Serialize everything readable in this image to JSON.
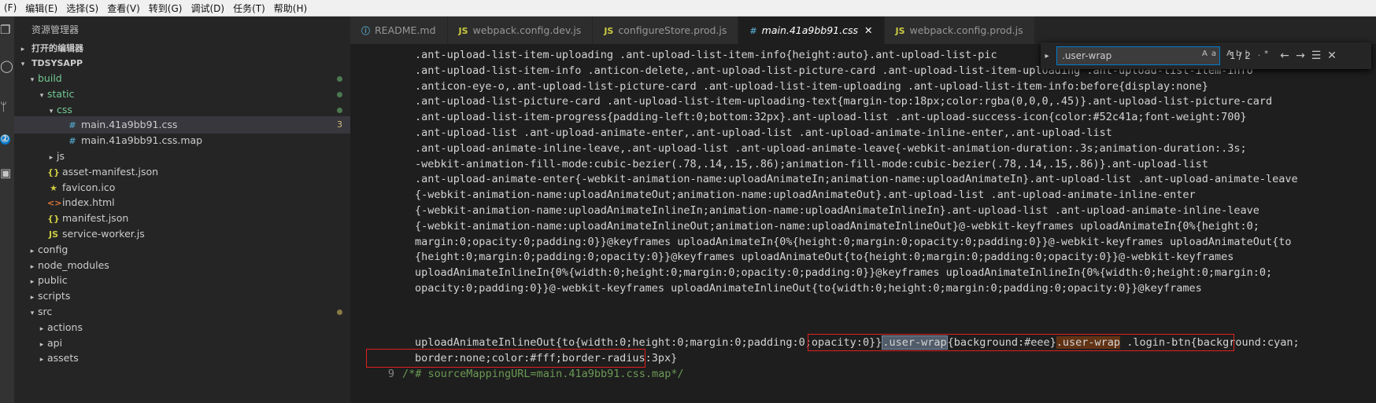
{
  "menu": [
    "(F)",
    "编辑(E)",
    "选择(S)",
    "查看(V)",
    "转到(G)",
    "调试(D)",
    "任务(T)",
    "帮助(H)"
  ],
  "sidebar": {
    "title": "资源管理器",
    "sections": {
      "open_editors": "打开的编辑器",
      "project": "TDSYSAPP"
    },
    "tree": [
      {
        "label": "build",
        "indent": 1,
        "twisty": "▾",
        "icon": "",
        "mod": true,
        "dot": "green"
      },
      {
        "label": "static",
        "indent": 2,
        "twisty": "▾",
        "icon": "",
        "mod": true,
        "dot": "green"
      },
      {
        "label": "css",
        "indent": 3,
        "twisty": "▾",
        "icon": "",
        "mod": true,
        "dot": "green"
      },
      {
        "label": "main.41a9bb91.css",
        "indent": 4,
        "twisty": "",
        "icon": "#",
        "iconColor": "#519aba",
        "selected": true,
        "count": "3"
      },
      {
        "label": "main.41a9bb91.css.map",
        "indent": 4,
        "twisty": "",
        "icon": "#",
        "iconColor": "#519aba"
      },
      {
        "label": "js",
        "indent": 3,
        "twisty": "▸",
        "icon": ""
      },
      {
        "label": "asset-manifest.json",
        "indent": 2,
        "twisty": "",
        "icon": "{}",
        "iconColor": "#cbcb41"
      },
      {
        "label": "favicon.ico",
        "indent": 2,
        "twisty": "",
        "icon": "★",
        "iconColor": "#cbcb41"
      },
      {
        "label": "index.html",
        "indent": 2,
        "twisty": "",
        "icon": "<>",
        "iconColor": "#e37933"
      },
      {
        "label": "manifest.json",
        "indent": 2,
        "twisty": "",
        "icon": "{}",
        "iconColor": "#cbcb41"
      },
      {
        "label": "service-worker.js",
        "indent": 2,
        "twisty": "",
        "icon": "JS",
        "iconColor": "#cbcb41"
      },
      {
        "label": "config",
        "indent": 1,
        "twisty": "▸",
        "icon": ""
      },
      {
        "label": "node_modules",
        "indent": 1,
        "twisty": "▸",
        "icon": ""
      },
      {
        "label": "public",
        "indent": 1,
        "twisty": "▸",
        "icon": ""
      },
      {
        "label": "scripts",
        "indent": 1,
        "twisty": "▸",
        "icon": ""
      },
      {
        "label": "src",
        "indent": 1,
        "twisty": "▾",
        "icon": "",
        "dot": "brown"
      },
      {
        "label": "actions",
        "indent": 2,
        "twisty": "▸",
        "icon": ""
      },
      {
        "label": "api",
        "indent": 2,
        "twisty": "▸",
        "icon": ""
      },
      {
        "label": "assets",
        "indent": 2,
        "twisty": "▸",
        "icon": ""
      }
    ]
  },
  "tabs": [
    {
      "label": "README.md",
      "icon": "ⓘ",
      "iconColor": "#519aba"
    },
    {
      "label": "webpack.config.dev.js",
      "icon": "JS",
      "iconColor": "#cbcb41"
    },
    {
      "label": "configureStore.prod.js",
      "icon": "JS",
      "iconColor": "#cbcb41"
    },
    {
      "label": "main.41a9bb91.css",
      "icon": "#",
      "iconColor": "#519aba",
      "active": true
    },
    {
      "label": "webpack.config.prod.js",
      "icon": "JS",
      "iconColor": "#cbcb41"
    }
  ],
  "code_lines": [
    ".ant-upload-list-item-uploading .ant-upload-list-item-info{height:auto}.ant-upload-list-pic",
    ".ant-upload-list-item-info .anticon-delete,.ant-upload-list-picture-card .ant-upload-list-item-uploading .ant-upload-list-item-info",
    ".anticon-eye-o,.ant-upload-list-picture-card .ant-upload-list-item-uploading .ant-upload-list-item-info:before{display:none}",
    ".ant-upload-list-picture-card .ant-upload-list-item-uploading-text{margin-top:18px;color:rgba(0,0,0,.45)}.ant-upload-list-picture-card",
    ".ant-upload-list-item-progress{padding-left:0;bottom:32px}.ant-upload-list .ant-upload-success-icon{color:#52c41a;font-weight:700}",
    ".ant-upload-list .ant-upload-animate-enter,.ant-upload-list .ant-upload-animate-inline-enter,.ant-upload-list",
    ".ant-upload-animate-inline-leave,.ant-upload-list .ant-upload-animate-leave{-webkit-animation-duration:.3s;animation-duration:.3s;",
    "-webkit-animation-fill-mode:cubic-bezier(.78,.14,.15,.86);animation-fill-mode:cubic-bezier(.78,.14,.15,.86)}.ant-upload-list",
    ".ant-upload-animate-enter{-webkit-animation-name:uploadAnimateIn;animation-name:uploadAnimateIn}.ant-upload-list .ant-upload-animate-leave",
    "{-webkit-animation-name:uploadAnimateOut;animation-name:uploadAnimateOut}.ant-upload-list .ant-upload-animate-inline-enter",
    "{-webkit-animation-name:uploadAnimateInlineIn;animation-name:uploadAnimateInlineIn}.ant-upload-list .ant-upload-animate-inline-leave",
    "{-webkit-animation-name:uploadAnimateInlineOut;animation-name:uploadAnimateInlineOut}@-webkit-keyframes uploadAnimateIn{0%{height:0;",
    "margin:0;opacity:0;padding:0}}@keyframes uploadAnimateIn{0%{height:0;margin:0;opacity:0;padding:0}}@-webkit-keyframes uploadAnimateOut{to",
    "{height:0;margin:0;padding:0;opacity:0}}@keyframes uploadAnimateOut{to{height:0;margin:0;padding:0;opacity:0}}@-webkit-keyframes",
    "uploadAnimateInlineIn{0%{width:0;height:0;margin:0;opacity:0;padding:0}}@keyframes uploadAnimateInlineIn{0%{width:0;height:0;margin:0;",
    "opacity:0;padding:0}}@-webkit-keyframes uploadAnimateInlineOut{to{width:0;height:0;margin:0;padding:0;opacity:0}}@keyframes"
  ],
  "line_hl": {
    "pre": "uploadAnimateInlineOut{to{width:0;height:0;margin:0;padding:0;opacity:0}}",
    "m1": ".user-wrap",
    "mid": "{background:#eee}",
    "m2": ".user-wrap",
    "post": " .login-btn{background:cyan;"
  },
  "line_last": "border:none;color:#fff;border-radius:3px}",
  "line9": {
    "num": "9",
    "text": "/*# sourceMappingURL=main.41a9bb91.css.map*/"
  },
  "find": {
    "query": ".user-wrap",
    "options": "Aa Ab| .*",
    "count": "1 / 2"
  },
  "icons": {
    "prev": "←",
    "next": "→",
    "selection": "☰",
    "close": "✕",
    "toggle": "▸"
  }
}
